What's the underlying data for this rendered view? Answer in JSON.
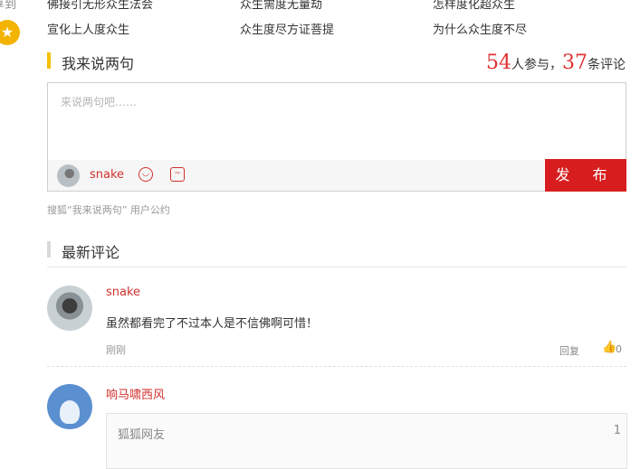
{
  "rail": {
    "text": "享到",
    "star_icon": "star-icon"
  },
  "related": [
    [
      "佛接引无形众生法会",
      "众生需度无量劫",
      "怎样度化超众生"
    ],
    [
      "宣化上人度众生",
      "众生度尽方证菩提",
      "为什么众生度不尽"
    ]
  ],
  "comment_section": {
    "title": "我来说两句",
    "participants": "54",
    "participants_label": "人参与，",
    "comments": "37",
    "comments_label": "条评论"
  },
  "editor": {
    "placeholder": "来说两句吧……",
    "username": "snake",
    "emoji_icon": "emoji-icon",
    "image_icon": "image-icon",
    "publish_label": "发 布"
  },
  "agreement": "搜狐“我来说两句” 用户公约",
  "latest": {
    "title": "最新评论",
    "items": [
      {
        "user": "snake",
        "text": "虽然都看完了不过本人是不信佛啊可惜！",
        "time": "刚刚",
        "reply": "回复",
        "likes": "0"
      },
      {
        "user": "响马啸西风",
        "quote_user": "狐狐网友",
        "quote_floor": "1"
      }
    ]
  },
  "colors": {
    "accent": "#d71d1d",
    "section_bar": "#f5c000"
  }
}
